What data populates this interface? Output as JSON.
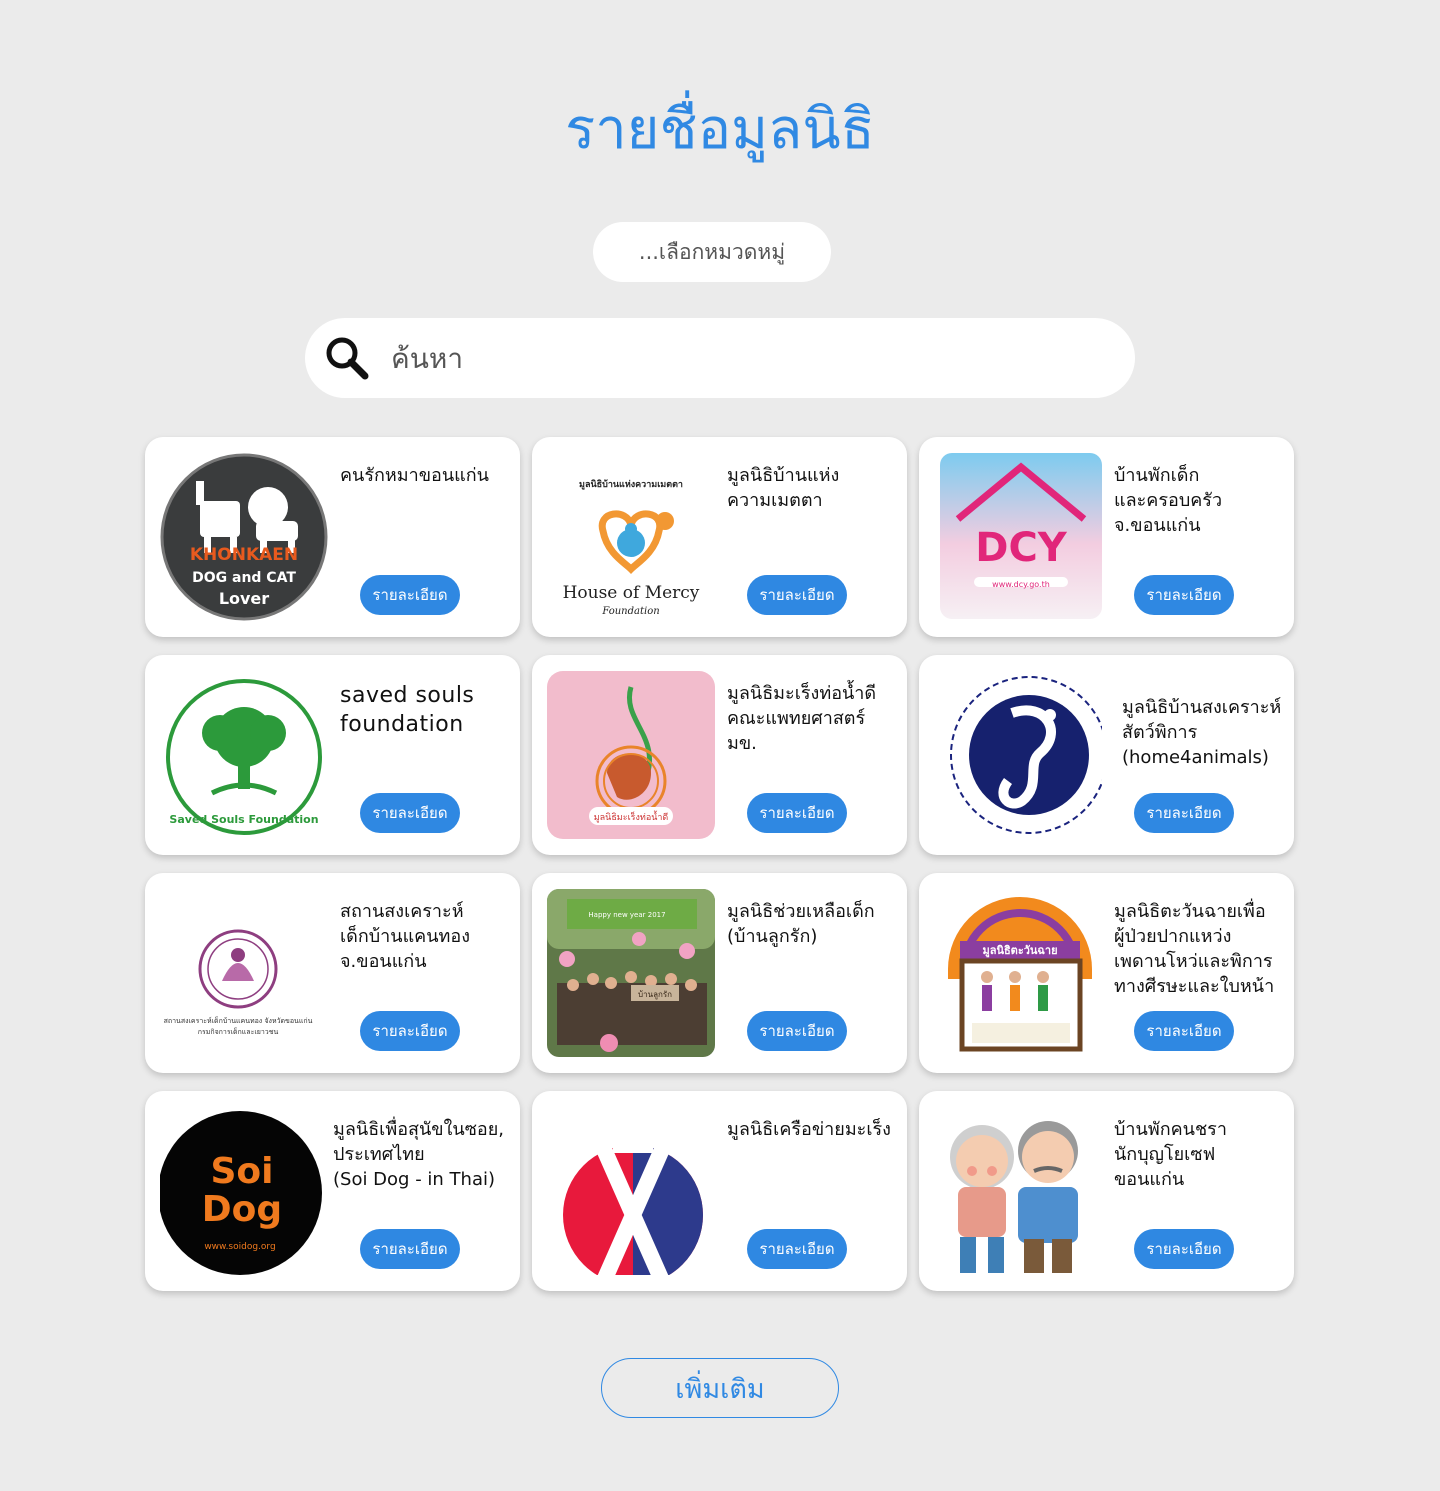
{
  "page": {
    "title": "รายชื่อมูลนิธิ"
  },
  "filter": {
    "category_label": "...เลือกหมวดหมู่"
  },
  "search": {
    "placeholder": "ค้นหา"
  },
  "cards": [
    {
      "name": "คนรักหมาขอนแก่น",
      "button": "รายละเอียด",
      "logo_text": [
        "KHONKAEN",
        "DOG and CAT",
        "Lover"
      ]
    },
    {
      "name": "มูลนิธิบ้านแห่ง\nความเมตตา",
      "button": "รายละเอียด",
      "logo_text": [
        "มูลนิธิบ้านแห่งความเมตตา",
        "House of Mercy",
        "Foundation"
      ]
    },
    {
      "name": "บ้านพักเด็ก\nและครอบครัว\nจ.ขอนแก่น",
      "button": "รายละเอียด",
      "logo_text": [
        "DCY",
        "www.dcy.go.th"
      ]
    },
    {
      "name": "saved souls\nfoundation",
      "button": "รายละเอียด",
      "logo_text": [
        "Saved Souls Foundation"
      ]
    },
    {
      "name": "มูลนิธิมะเร็งท่อน้ำดี\nคณะแพทยศาสตร์\nมข.",
      "button": "รายละเอียด",
      "logo_text": [
        "มูลนิธิมะเร็งท่อน้ำดี"
      ]
    },
    {
      "name": "มูลนิธิบ้านสงเคราะห์\nสัตว์พิการ\n(home4animals)",
      "button": "รายละเอียด",
      "logo_text": []
    },
    {
      "name": "สถานสงเคราะห์\nเด็กบ้านแคนทอง\nจ.ขอนแก่น",
      "button": "รายละเอียด",
      "logo_text": [
        "สถานสงเคราะห์เด็กบ้านแคนทอง จังหวัดขอนแก่น",
        "กรมกิจการเด็กและเยาวชน"
      ]
    },
    {
      "name": "มูลนิธิช่วยเหลือเด็ก\n(บ้านลูกรัก)",
      "button": "รายละเอียด",
      "logo_text": [
        "Happy new year 2017",
        "บ้านลูกรัก"
      ]
    },
    {
      "name": "มูลนิธิตะวันฉายเพื่อ\nผู้ป่วยปากแหว่ง\nเพดานโหว่และพิการ\nทางศีรษะและใบหน้า",
      "button": "รายละเอียด",
      "logo_text": [
        "มูลนิธิตะวันฉาย"
      ]
    },
    {
      "name": "มูลนิธิเพื่อสุนัขในซอย,\nประเทศไทย\n(Soi Dog - in Thai)",
      "button": "รายละเอียด",
      "logo_text": [
        "Soi",
        "Dog",
        "www.soidog.org"
      ]
    },
    {
      "name": "มูลนิธิเครือข่ายมะเร็ง",
      "button": "รายละเอียด",
      "logo_text": []
    },
    {
      "name": "บ้านพักคนชรา\nนักบุญโยเซฟ\nขอนแก่น",
      "button": "รายละเอียด",
      "logo_text": []
    }
  ],
  "load_more": {
    "label": "เพิ่มเติม"
  }
}
